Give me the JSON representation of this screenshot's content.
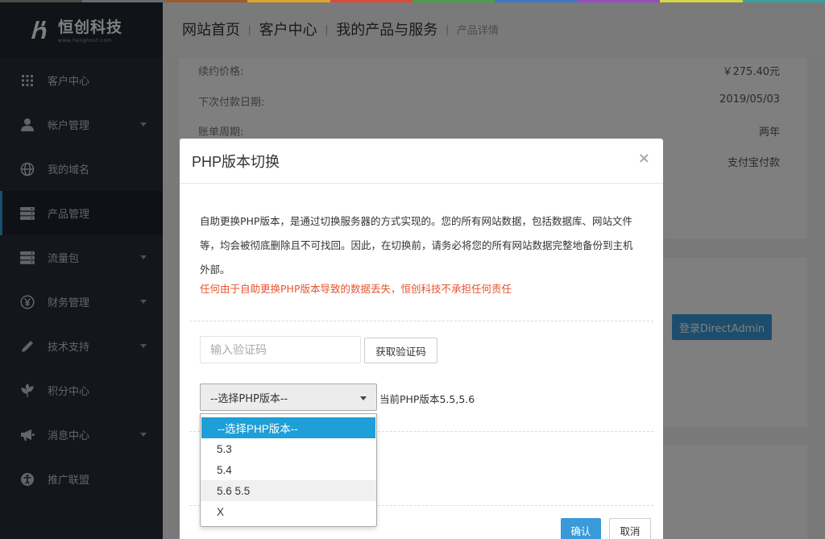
{
  "colors": {
    "sidebar_bg": "#262c37",
    "accent": "#3a9ad9",
    "warning": "#e8532f",
    "dropdown_selected": "#1e9fd8",
    "strip": [
      "#4b4b4b",
      "#6c6c6c",
      "#9e5a2c",
      "#e0a32a",
      "#d94a3a",
      "#4aa04a",
      "#3a78c8",
      "#9b4bc0",
      "#d6d64a",
      "#3aa0a0"
    ]
  },
  "brand": {
    "name": "恒创科技",
    "url": "www.henghost.com",
    "logo_icon": "henghost-logo-icon"
  },
  "sidebar": {
    "items": [
      {
        "label": "客户中心",
        "icon": "grid-icon",
        "caret": false,
        "active": false
      },
      {
        "label": "帐户管理",
        "icon": "user-icon",
        "caret": true,
        "active": false
      },
      {
        "label": "我的域名",
        "icon": "globe-icon",
        "caret": false,
        "active": false
      },
      {
        "label": "产品管理",
        "icon": "server-icon",
        "caret": false,
        "active": true
      },
      {
        "label": "流量包",
        "icon": "server-icon",
        "caret": true,
        "active": false
      },
      {
        "label": "财务管理",
        "icon": "yen-icon",
        "caret": true,
        "active": false
      },
      {
        "label": "技术支持",
        "icon": "pencil-icon",
        "caret": true,
        "active": false
      },
      {
        "label": "积分中心",
        "icon": "leaf-icon",
        "caret": false,
        "active": false
      },
      {
        "label": "消息中心",
        "icon": "megaphone-icon",
        "caret": true,
        "active": false
      },
      {
        "label": "推广联盟",
        "icon": "accessibility-icon",
        "caret": false,
        "active": false
      }
    ]
  },
  "breadcrumb": {
    "items": [
      "网站首页",
      "客户中心",
      "我的产品与服务"
    ],
    "current": "产品详情",
    "separator": "|"
  },
  "details": {
    "rows": [
      {
        "key": "续约价格:",
        "value": "￥275.40元"
      },
      {
        "key": "下次付款日期:",
        "value": "2019/05/03"
      },
      {
        "key": "账单周期:",
        "value": "两年"
      },
      {
        "key": "",
        "value": "支付宝付款"
      }
    ],
    "directadmin_label": "登录DirectAdmin"
  },
  "modal": {
    "title": "PHP版本切换",
    "close": "×",
    "desc_lines": [
      "自助更换PHP版本，是通过切换服务器的方式实现的。您的所有网站数据，包括数据库、网站文件",
      "等，均会被彻底删除且不可找回。因此，在切换前，请务必将您的所有网站数据完整地备份到主机",
      "外部。"
    ],
    "warning": "任何由于自助更换PHP版本导致的数据丢失，恒创科技不承担任何责任",
    "code_placeholder": "输入验证码",
    "code_button": "获取验证码",
    "select_value": "--选择PHP版本--",
    "current_version": "当前PHP版本5.5,5.6",
    "options": [
      "--选择PHP版本--",
      "5.3",
      "5.4",
      "5.6 5.5",
      "X"
    ],
    "confirm": "确认",
    "cancel": "取消"
  }
}
